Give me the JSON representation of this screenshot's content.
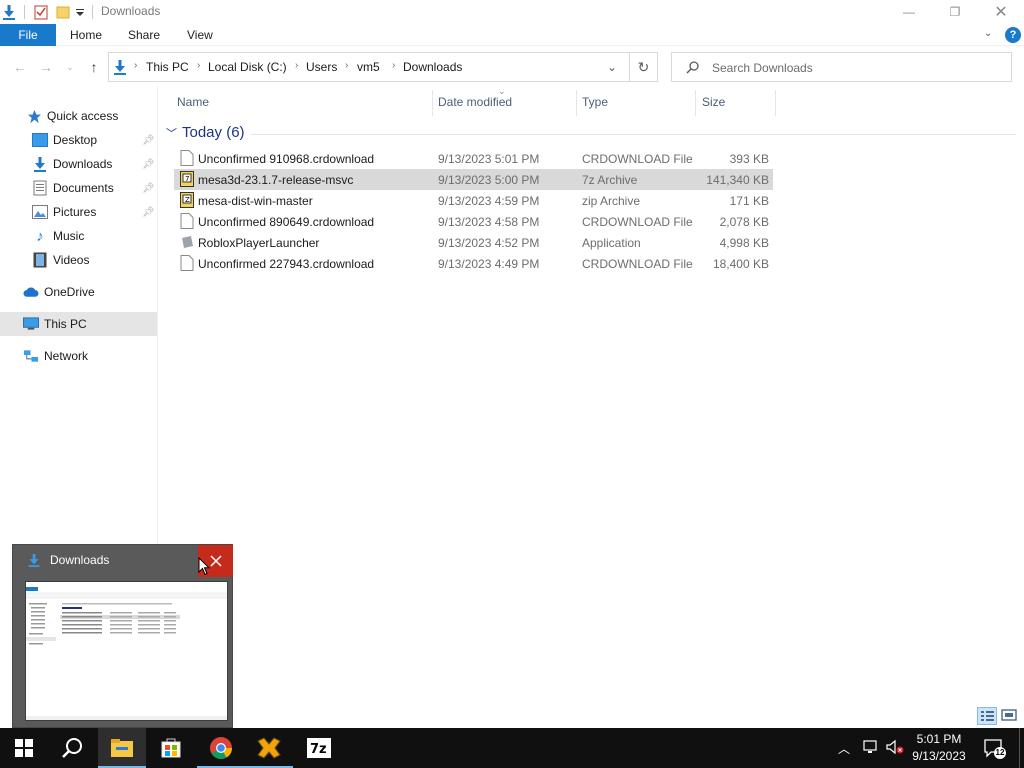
{
  "window": {
    "title": "Downloads",
    "controls": {
      "minimize": "—",
      "restore": "❐",
      "close": "✕"
    }
  },
  "ribbon": {
    "tabs": [
      "File",
      "Home",
      "Share",
      "View"
    ]
  },
  "address": {
    "crumbs": [
      "This PC",
      "Local Disk (C:)",
      "Users",
      "vm5",
      "Downloads"
    ],
    "search_placeholder": "Search Downloads"
  },
  "nav": {
    "items": [
      {
        "label": "Quick access",
        "icon": "star-icon",
        "pinned": false
      },
      {
        "label": "Desktop",
        "icon": "desktop-icon",
        "pinned": true
      },
      {
        "label": "Downloads",
        "icon": "download-icon",
        "pinned": true
      },
      {
        "label": "Documents",
        "icon": "documents-icon",
        "pinned": true
      },
      {
        "label": "Pictures",
        "icon": "pictures-icon",
        "pinned": true
      },
      {
        "label": "Music",
        "icon": "music-icon",
        "pinned": false
      },
      {
        "label": "Videos",
        "icon": "videos-icon",
        "pinned": false
      },
      {
        "label": "OneDrive",
        "icon": "cloud-icon",
        "pinned": false
      },
      {
        "label": "This PC",
        "icon": "computer-icon",
        "pinned": false,
        "selected": true
      },
      {
        "label": "Network",
        "icon": "network-icon",
        "pinned": false
      }
    ]
  },
  "columns": {
    "name": "Name",
    "date": "Date modified",
    "type": "Type",
    "size": "Size"
  },
  "group": {
    "label": "Today (6)"
  },
  "files": [
    {
      "name": "Unconfirmed 910968.crdownload",
      "date": "9/13/2023 5:01 PM",
      "type": "CRDOWNLOAD File",
      "size": "393 KB",
      "icon": "file-icon"
    },
    {
      "name": "mesa3d-23.1.7-release-msvc",
      "date": "9/13/2023 5:00 PM",
      "type": "7z Archive",
      "size": "141,340 KB",
      "icon": "archive-icon",
      "selected": true
    },
    {
      "name": "mesa-dist-win-master",
      "date": "9/13/2023 4:59 PM",
      "type": "zip Archive",
      "size": "171 KB",
      "icon": "archive-icon"
    },
    {
      "name": "Unconfirmed 890649.crdownload",
      "date": "9/13/2023 4:58 PM",
      "type": "CRDOWNLOAD File",
      "size": "2,078 KB",
      "icon": "file-icon"
    },
    {
      "name": "RobloxPlayerLauncher",
      "date": "9/13/2023 4:52 PM",
      "type": "Application",
      "size": "4,998 KB",
      "icon": "application-icon"
    },
    {
      "name": "Unconfirmed 227943.crdownload",
      "date": "9/13/2023 4:49 PM",
      "type": "CRDOWNLOAD File",
      "size": "18,400 KB",
      "icon": "file-icon"
    }
  ],
  "thumbnail": {
    "title": "Downloads"
  },
  "taskbar": {
    "apps": [
      "start-icon",
      "search-icon",
      "file-explorer-icon",
      "store-icon",
      "chrome-icon",
      "vmware-icon",
      "7zip-icon"
    ],
    "clock_time": "5:01 PM",
    "clock_date": "9/13/2023",
    "notification_count": "12"
  },
  "colors": {
    "accent": "#1979ca",
    "selection": "#d9d9d9",
    "taskbar": "#101010",
    "close_red": "#c42b1c"
  }
}
